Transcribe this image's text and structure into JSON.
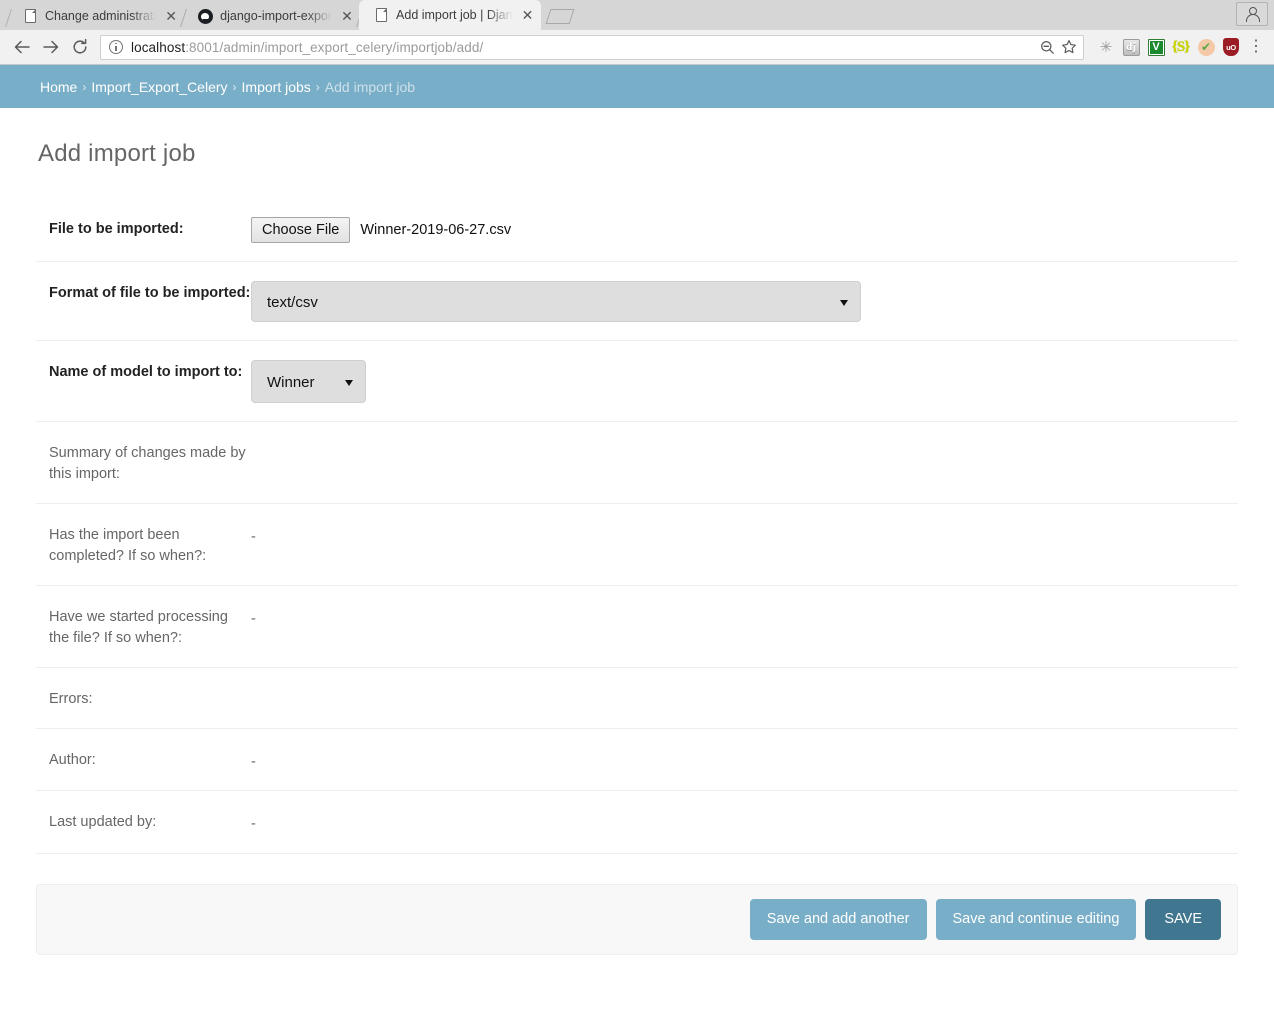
{
  "browser": {
    "tabs": [
      {
        "title": "Change administrati",
        "favicon": "document-icon",
        "active": false
      },
      {
        "title": "django-import-expor",
        "favicon": "github-icon",
        "active": false
      },
      {
        "title": "Add import job | Djan",
        "favicon": "document-icon",
        "active": true
      }
    ],
    "new_tab_label": "+",
    "window_control": "profile-avatar",
    "nav": {
      "back": "back-arrow-icon",
      "forward": "forward-arrow-icon",
      "reload": "reload-icon"
    },
    "omnibox": {
      "site_info": "info-circle-icon",
      "url_host": "localhost",
      "url_path": ":8001/admin/import_export_celery/importjob/add/",
      "zoom_icon": "zoom-out-icon",
      "bookmark_icon": "star-icon"
    },
    "extensions": [
      {
        "name": "sparkle-extension-icon",
        "glyph": "✳"
      },
      {
        "name": "django-debug-toolbar-icon",
        "glyph": "dj"
      },
      {
        "name": "vimium-extension-icon",
        "glyph": "V"
      },
      {
        "name": "json-formatter-extension-icon",
        "glyph": "S"
      },
      {
        "name": "peach-extension-icon",
        "glyph": "✔"
      },
      {
        "name": "ublock-origin-icon",
        "glyph": "uO"
      }
    ],
    "menu_icon": "⋮"
  },
  "breadcrumbs": {
    "home": "Home",
    "app": "Import_Export_Celery",
    "model": "Import jobs",
    "current": "Add import job",
    "separator": "›"
  },
  "page": {
    "title": "Add import job"
  },
  "form": {
    "rows": [
      {
        "label": "File to be imported:",
        "type": "file",
        "bold": true,
        "button_label": "Choose File",
        "file_name": "Winner-2019-06-27.csv"
      },
      {
        "label": "Format of file to be imported:",
        "type": "select-wide",
        "bold": true,
        "value": "text/csv"
      },
      {
        "label": "Name of model to import to:",
        "type": "select-narrow",
        "bold": true,
        "value": "Winner"
      },
      {
        "label": "Summary of changes made by this import:",
        "type": "readonly",
        "bold": false,
        "value": ""
      },
      {
        "label": "Has the import been completed? If so when?:",
        "type": "readonly",
        "bold": false,
        "value": "-"
      },
      {
        "label": "Have we started processing the file? If so when?:",
        "type": "readonly",
        "bold": false,
        "value": "-"
      },
      {
        "label": "Errors:",
        "type": "readonly",
        "bold": false,
        "value": ""
      },
      {
        "label": "Author:",
        "type": "readonly",
        "bold": false,
        "value": "-"
      },
      {
        "label": "Last updated by:",
        "type": "readonly",
        "bold": false,
        "value": "-"
      }
    ]
  },
  "submit_row": {
    "save_and_add_another": "Save and add another",
    "save_and_continue": "Save and continue editing",
    "save": "SAVE"
  },
  "colors": {
    "breadcrumb_bg": "#79aec8",
    "button_light": "#79aec8",
    "button_dark": "#417690",
    "label_readonly": "#666666",
    "heading": "#666666"
  }
}
